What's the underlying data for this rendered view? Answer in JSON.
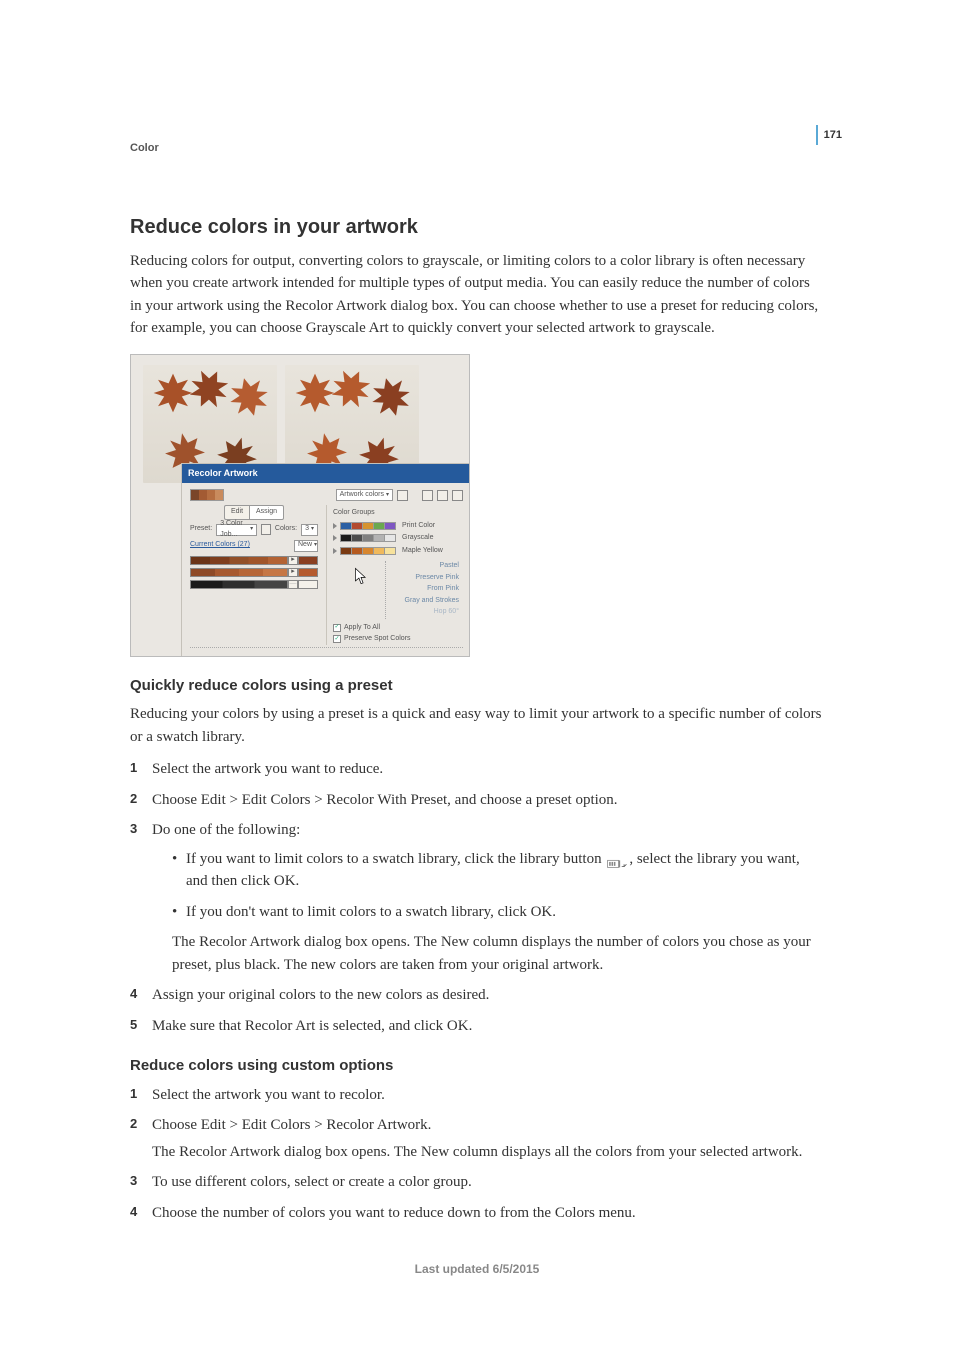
{
  "page_number": "171",
  "breadcrumb": "Color",
  "h2": "Reduce colors in your artwork",
  "intro": "Reducing colors for output, converting colors to grayscale, or limiting colors to a color library is often necessary when you create artwork intended for multiple types of output media. You can easily reduce the number of colors in your artwork using the Recolor Artwork dialog box. You can choose whether to use a preset for reducing colors, for example, you can choose Grayscale Art to quickly convert your selected artwork to grayscale.",
  "dialog": {
    "title": "Recolor Artwork",
    "artwork_colors_label": "Artwork colors",
    "tabs": {
      "edit": "Edit",
      "assign": "Assign"
    },
    "preset_label": "Preset:",
    "preset_value": "3 Color Job...",
    "colors_label": "Colors:",
    "colors_value": "3",
    "current_label": "Current Colors (27)",
    "new_label": "New",
    "color_groups_label": "Color Groups",
    "groups": [
      {
        "name": "Print Color",
        "swatches": [
          "#2b5fa3",
          "#b34a2e",
          "#d6932f",
          "#6aa84f",
          "#7e57c2"
        ]
      },
      {
        "name": "Grayscale",
        "swatches": [
          "#1a1a1a",
          "#4d4d4d",
          "#808080",
          "#b3b3b3",
          "#e6e6e6"
        ]
      },
      {
        "name": "Maple Yellow",
        "swatches": [
          "#7a3a12",
          "#b55a1f",
          "#d7862e",
          "#f0b95c",
          "#f7e29c"
        ]
      }
    ],
    "right_names": [
      "Pastel",
      "Preserve Pink",
      "From Pink",
      "Gray and Strokes",
      "Hop 60°"
    ],
    "apply_all": "Apply To All",
    "preserve_spot": "Preserve Spot Colors"
  },
  "section1": {
    "h3": "Quickly reduce colors using a preset",
    "p": "Reducing your colors by using a preset is a quick and easy way to limit your artwork to a specific number of colors or a swatch library.",
    "steps": [
      "Select the artwork you want to reduce.",
      "Choose Edit > Edit Colors > Recolor With Preset, and choose a preset option.",
      "Do one of the following:"
    ],
    "bullets_a": "If you want to limit colors to a swatch library, click the library button ",
    "bullets_a2": ", select the library you want, and then click OK.",
    "bullets_b": "If you don't want to limit colors to a swatch library, click OK.",
    "note": "The Recolor Artwork dialog box opens. The New column displays the number of colors you chose as your preset, plus black. The new colors are taken from your original artwork.",
    "steps2": [
      "Assign your original colors to the new colors as desired.",
      "Make sure that Recolor Art is selected, and click OK."
    ]
  },
  "section2": {
    "h3": "Reduce colors using custom options",
    "steps": [
      "Select the artwork you want to recolor.",
      "Choose Edit > Edit Colors > Recolor Artwork."
    ],
    "note": "The Recolor Artwork dialog box opens. The New column displays all the colors from your selected artwork.",
    "steps2": [
      "To use different colors, select or create a color group.",
      "Choose the number of colors you want to reduce down to from the Colors menu."
    ]
  },
  "footer": "Last updated 6/5/2015"
}
